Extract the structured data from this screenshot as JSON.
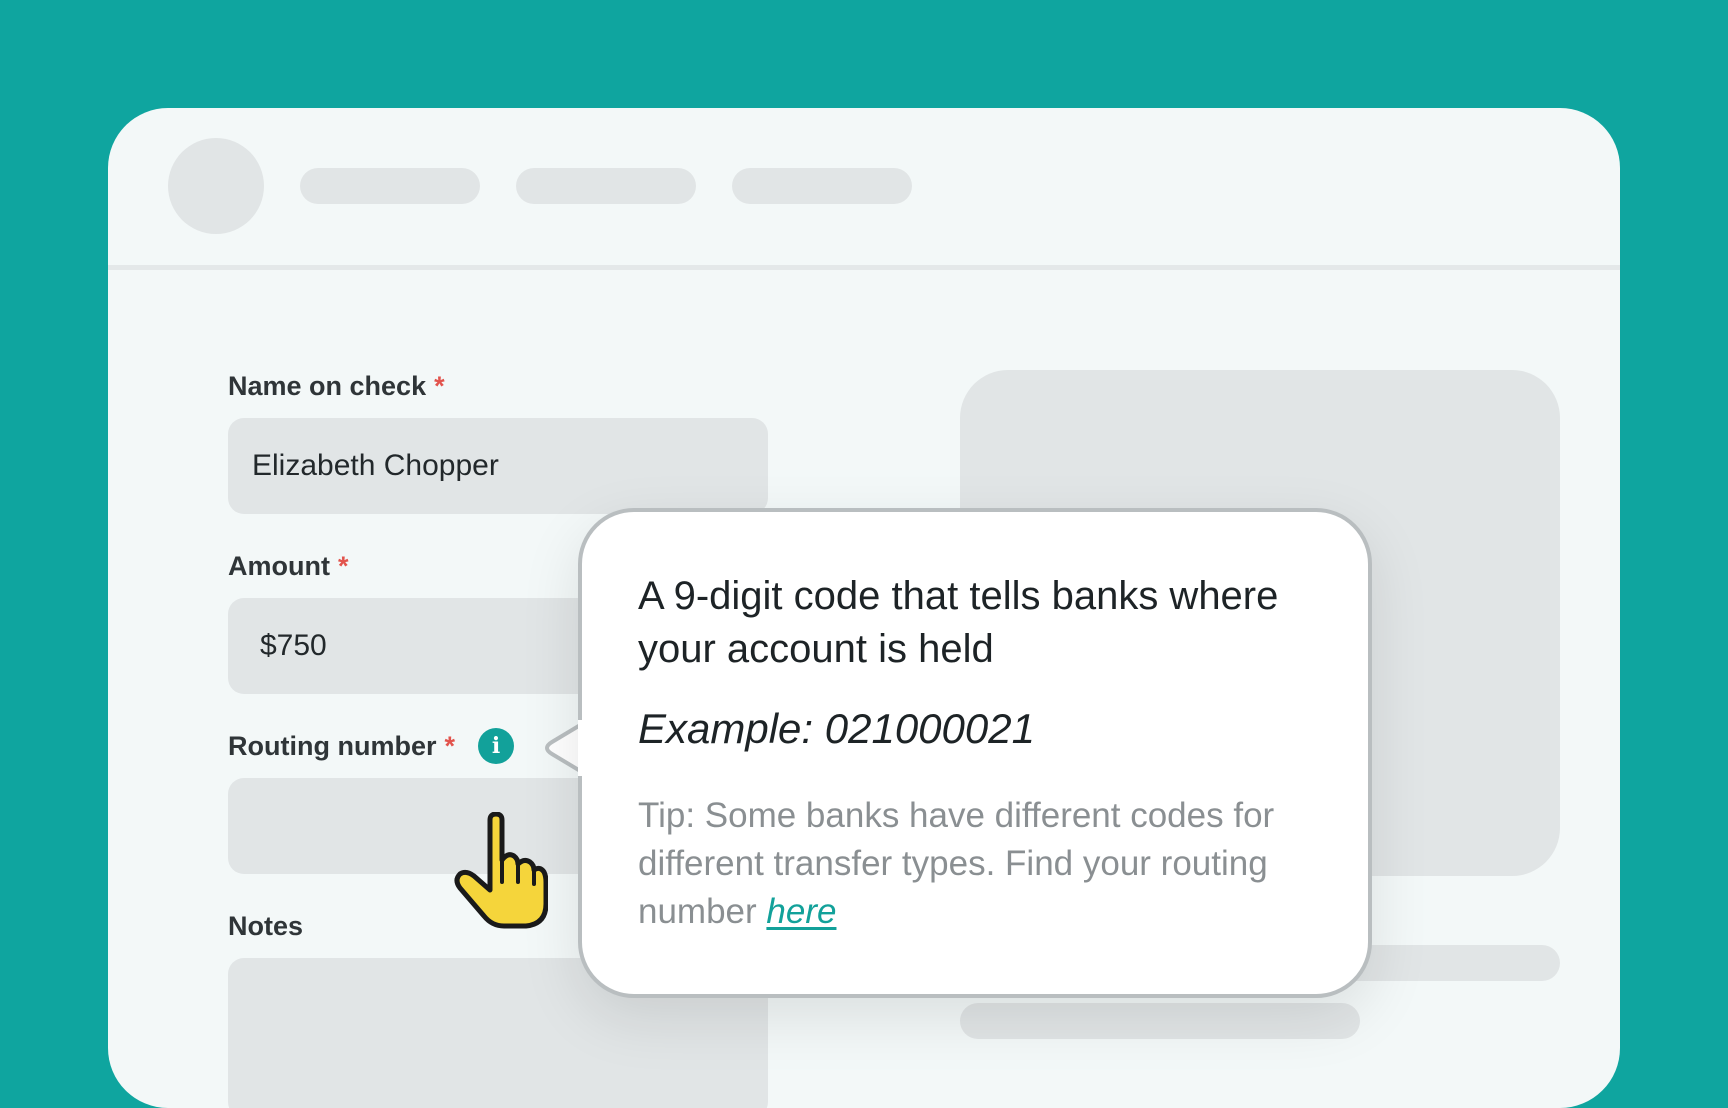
{
  "form": {
    "name_label": "Name on check",
    "name_value": "Elizabeth Chopper",
    "amount_label": "Amount",
    "amount_value": "$750",
    "routing_label": "Routing number",
    "routing_value": "",
    "notes_label": "Notes",
    "notes_value": "",
    "required_marker": "*"
  },
  "info_icon": {
    "glyph": "i",
    "icon": "info-icon"
  },
  "tooltip": {
    "title": "A 9-digit code that tells banks where your account is held",
    "example": "Example: 021000021",
    "tip_text": "Tip: Some banks have different codes for different transfer types. Find your routing number ",
    "tip_link": "here"
  },
  "colors": {
    "background": "#0fa59f",
    "accent": "#12a19a",
    "required": "#e2544d",
    "cursor": "#f5d53b"
  }
}
